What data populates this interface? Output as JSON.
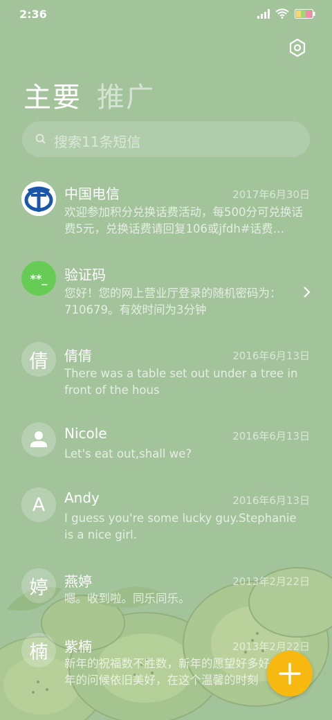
{
  "status": {
    "time": "2:36"
  },
  "header": {
    "tab_primary": "主要",
    "tab_promo": "推广",
    "settings_icon": "gear-hexagon-icon"
  },
  "search": {
    "placeholder": "搜索11条短信"
  },
  "messages": [
    {
      "sender": "中国电信",
      "date": "2017年6月30日",
      "preview": "欢迎参加积分兑换话费活动，每500分可兑换话费5元，兑换话费请回复106或jfdh#话费…",
      "avatar": "china-telecom-logo"
    },
    {
      "sender": "验证码",
      "date": "",
      "preview": "您好！您的网上营业厅登录的随机密码为：710679。有效时间为3分钟",
      "avatar_text": "**_",
      "avatar_color": "#66cc55"
    },
    {
      "sender": "倩倩",
      "date": "2016年6月13日",
      "preview": "There was a table set out under a tree in front of the hous",
      "avatar_text": "倩"
    },
    {
      "sender": "Nicole",
      "date": "2016年6月13日",
      "preview": "Let's eat out,shall we?",
      "avatar": "person-icon"
    },
    {
      "sender": "Andy",
      "date": "2016年6月13日",
      "preview": "I guess you're some lucky guy.Stephanie is a nice girl.",
      "avatar_text": "A"
    },
    {
      "sender": "燕婷",
      "date": "2013年2月22日",
      "preview": "嗯。收到啦。同乐同乐。",
      "avatar_text": "婷"
    },
    {
      "sender": "紫楠",
      "date": "2013年2月22日",
      "preview": "新年的祝福数不胜数，新年的愿望好多好多，新年的问候依旧美好，在这个温馨的时刻",
      "avatar_text": "楠"
    }
  ],
  "fab": {
    "icon": "plus-icon",
    "color": "#f7b90f"
  }
}
